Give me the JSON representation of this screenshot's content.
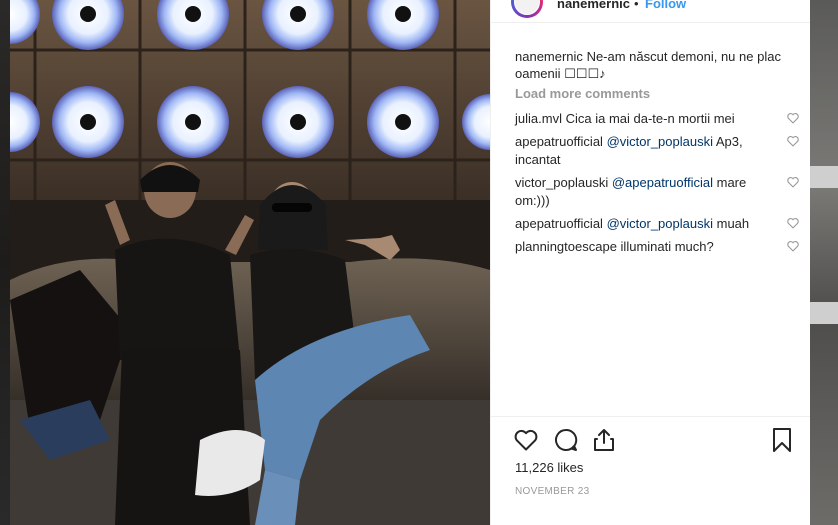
{
  "post": {
    "username": "nanemernic",
    "separator": "•",
    "follow_label": "Follow",
    "caption_user": "nanemernic",
    "caption_text": "Ne-am născut demoni, nu ne plac oamenii ☐☐☐♪",
    "load_more_label": "Load more comments",
    "comments": [
      {
        "user": "julia.mvl",
        "mention": "",
        "text": "Cica ia mai da-te-n mortii mei"
      },
      {
        "user": "apepatruofficial",
        "mention": "@victor_poplauski",
        "text": "Ap3, incantat"
      },
      {
        "user": "victor_poplauski",
        "mention": "@apepatruofficial",
        "text": "mare om:)))"
      },
      {
        "user": "apepatruofficial",
        "mention": "@victor_poplauski",
        "text": "muah"
      },
      {
        "user": "planningtoescape",
        "mention": "",
        "text": "illuminati much?"
      }
    ],
    "likes_label": "11,226 likes",
    "date_label": "NOVEMBER 23"
  },
  "icons": {
    "like": "heart-outline-icon",
    "comment": "speech-bubble-icon",
    "share": "share-upload-icon",
    "save": "bookmark-icon"
  },
  "colors": {
    "link": "#003569",
    "follow": "#3897f0",
    "muted": "#999999",
    "text": "#262626"
  }
}
